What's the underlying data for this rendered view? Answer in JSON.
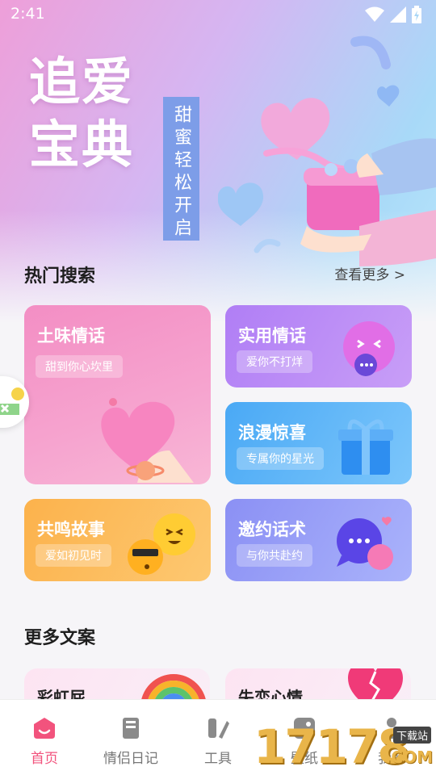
{
  "status_bar": {
    "time": "2:41",
    "icons": [
      "wifi-icon",
      "signal-icon",
      "battery-charging-icon"
    ]
  },
  "hero": {
    "title_line1": "追爱",
    "title_line2": "宝典",
    "tagline": "甜蜜轻松开启"
  },
  "hot_search": {
    "title": "热门搜索",
    "see_more": "查看更多 >",
    "cards": [
      {
        "title": "土味情话",
        "subtitle": "甜到你心坎里",
        "color": "#f38ec4",
        "icon": "heart-in-hand-icon"
      },
      {
        "title": "实用情话",
        "subtitle": "爱你不打烊",
        "color": "#b07ef5",
        "icon": "smiling-chat-bubble-icon"
      },
      {
        "title": "浪漫惊喜",
        "subtitle": "专属你的星光",
        "color": "#4aa9f5",
        "icon": "gift-box-icon"
      },
      {
        "title": "共鸣故事",
        "subtitle": "爱如初见时",
        "color": "#fcb24c",
        "icon": "emoji-faces-icon"
      },
      {
        "title": "邀约话术",
        "subtitle": "与你共赴约",
        "color": "#8b90f4",
        "icon": "chat-bubbles-icon"
      }
    ]
  },
  "more_copy": {
    "title": "更多文案",
    "cards": [
      {
        "title": "彩虹屁",
        "icon": "rainbow-icon"
      },
      {
        "title": "失恋心情",
        "icon": "broken-heart-icon"
      }
    ]
  },
  "bottom_nav": {
    "active_color": "#f2537d",
    "items": [
      {
        "label": "首页",
        "icon": "home-icon",
        "active": true
      },
      {
        "label": "情侣日记",
        "icon": "diary-icon",
        "active": false
      },
      {
        "label": "工具",
        "icon": "tools-icon",
        "active": false
      },
      {
        "label": "壁纸",
        "icon": "wallpaper-icon",
        "active": false
      },
      {
        "label": "我的",
        "icon": "profile-icon",
        "active": false
      }
    ]
  },
  "watermark": {
    "number": "17178",
    "badge": "下载站",
    "domain": ".COM"
  }
}
